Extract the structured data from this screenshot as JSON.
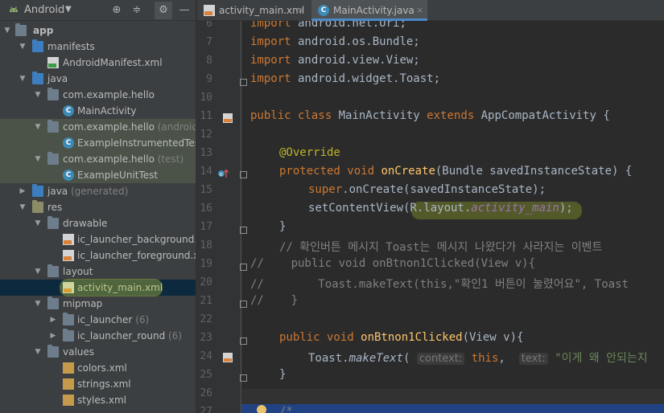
{
  "project_panel": {
    "view_label": "Android",
    "tree": [
      {
        "label": "app",
        "suffix": ""
      },
      {
        "label": "manifests",
        "suffix": ""
      },
      {
        "label": "AndroidManifest.xml",
        "suffix": ""
      },
      {
        "label": "java",
        "suffix": ""
      },
      {
        "label": "com.example.hello",
        "suffix": ""
      },
      {
        "label": "MainActivity",
        "suffix": ""
      },
      {
        "label": "com.example.hello",
        "suffix": "(androidTest)"
      },
      {
        "label": "ExampleInstrumentedTest",
        "suffix": ""
      },
      {
        "label": "com.example.hello",
        "suffix": "(test)"
      },
      {
        "label": "ExampleUnitTest",
        "suffix": ""
      },
      {
        "label": "java",
        "suffix": "(generated)"
      },
      {
        "label": "res",
        "suffix": ""
      },
      {
        "label": "drawable",
        "suffix": ""
      },
      {
        "label": "ic_launcher_background.xml",
        "suffix": ""
      },
      {
        "label": "ic_launcher_foreground.xml",
        "suffix": ""
      },
      {
        "label": "layout",
        "suffix": ""
      },
      {
        "label": "activity_main.xml",
        "suffix": ""
      },
      {
        "label": "mipmap",
        "suffix": ""
      },
      {
        "label": "ic_launcher",
        "suffix": "(6)"
      },
      {
        "label": "ic_launcher_round",
        "suffix": "(6)"
      },
      {
        "label": "values",
        "suffix": ""
      },
      {
        "label": "colors.xml",
        "suffix": ""
      },
      {
        "label": "strings.xml",
        "suffix": ""
      },
      {
        "label": "styles.xml",
        "suffix": ""
      }
    ]
  },
  "tabs": [
    {
      "label": "activity_main.xml",
      "close": "×"
    },
    {
      "label": "MainActivity.java",
      "close": "×"
    }
  ],
  "editor": {
    "line_numbers": [
      "6",
      "7",
      "8",
      "9",
      "10",
      "11",
      "12",
      "13",
      "14",
      "15",
      "16",
      "17",
      "18",
      "19",
      "20",
      "21",
      "22",
      "23",
      "24",
      "25",
      "26",
      "27"
    ],
    "lines": {
      "l6_kw": "import",
      "l6_rest": " android.net.Uri;",
      "l7_kw": "import",
      "l7_rest": " android.os.Bundle;",
      "l8_kw": "import",
      "l8_rest": " android.view.View;",
      "l9_kw": "import",
      "l9_rest": " android.widget.Toast;",
      "l11_kw1": "public class",
      "l11_name": " MainActivity ",
      "l11_kw2": "extends",
      "l11_rest": " AppCompatActivity {",
      "l13_ann": "@Override",
      "l14_kw": "protected void",
      "l14_fn": " onCreate",
      "l14_rest": "(Bundle savedInstanceState) {",
      "l15_kw": "super",
      "l15_rest": ".onCreate(savedInstanceState);",
      "l16_a": "setContentView(R.layout.",
      "l16_fld": "activity_main",
      "l16_b": ");",
      "l17": "}",
      "l18": "// 확인버튼 메시지 Toast는 메시지 나왔다가 사라지는 이벤트",
      "l19": "//    public void onBtnon1Clicked(View v){",
      "l20": "//        Toast.makeText(this,\"확인1 버튼이 눌렸어요\", Toast",
      "l21": "//    }",
      "l23_kw": "public void",
      "l23_fn": " onBtnon1Clicked",
      "l23_rest": "(View v){",
      "l24_a": "Toast.",
      "l24_it": "makeText",
      "l24_b": "( ",
      "l24_hint1": "context:",
      "l24_kw": " this",
      "l24_c": ",  ",
      "l24_hint2": "text:",
      "l24_str": " \"이게 왜 안되는지",
      "l25": "}",
      "l27": "/*"
    }
  }
}
